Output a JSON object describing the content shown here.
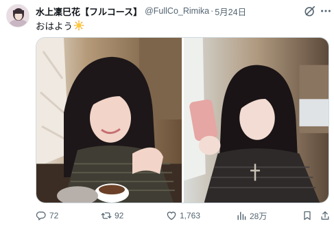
{
  "tweet": {
    "display_name": "水上凜巳花【フルコース】",
    "handle": "@FullCo_Rimika",
    "separator": "·",
    "date": "5月24日",
    "text": "おはよう",
    "text_emoji": "sun-icon",
    "actions": {
      "replies": "72",
      "retweets": "92",
      "likes": "1,763",
      "views": "28万"
    }
  },
  "icons": {
    "grok": "grok-icon",
    "more": "more-icon",
    "reply": "reply-icon",
    "retweet": "retweet-icon",
    "like": "heart-icon",
    "views": "views-icon",
    "bookmark": "bookmark-icon",
    "share": "share-icon"
  },
  "colors": {
    "text_primary": "#0f1419",
    "text_secondary": "#536471",
    "border": "#cfd9de"
  }
}
